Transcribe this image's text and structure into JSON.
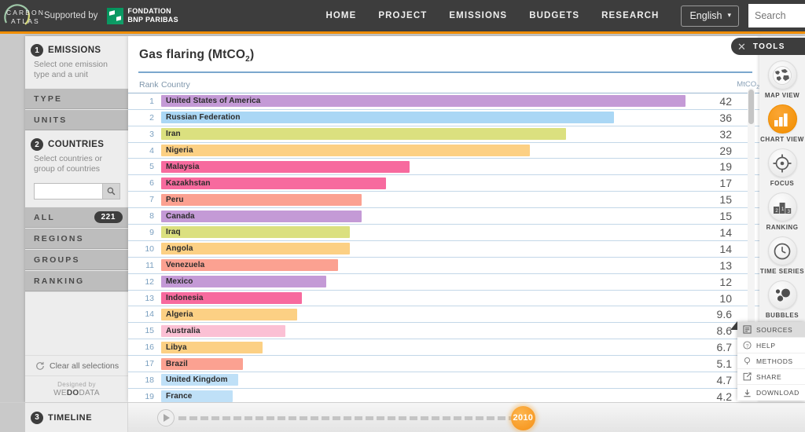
{
  "header": {
    "logo_line1": "CARBON",
    "logo_line2": "ATLAS",
    "supported_by": "Supported by",
    "sponsor_line1": "FONDATION",
    "sponsor_line2": "BNP PARIBAS",
    "nav": [
      {
        "label": "HOME"
      },
      {
        "label": "PROJECT"
      },
      {
        "label": "EMISSIONS"
      },
      {
        "label": "BUDGETS"
      },
      {
        "label": "RESEARCH"
      }
    ],
    "language": "English",
    "language_chevron": "▾",
    "search_placeholder": "Search",
    "search_value": "",
    "accent_color": "#f18e00"
  },
  "sidebar": {
    "emissions": {
      "number": "1",
      "title": "EMISSIONS",
      "subtitle": "Select one emission type and a unit",
      "rows": [
        {
          "label": "TYPE"
        },
        {
          "label": "UNITS"
        }
      ]
    },
    "countries": {
      "number": "2",
      "title": "COUNTRIES",
      "subtitle": "Select countries or group of countries",
      "search_value": "",
      "search_placeholder": "",
      "rows": [
        {
          "label": "ALL",
          "badge": "221"
        },
        {
          "label": "REGIONS",
          "badge": ""
        },
        {
          "label": "GROUPS",
          "badge": ""
        },
        {
          "label": "RANKING",
          "badge": ""
        }
      ]
    },
    "clear_all": "Clear all selections",
    "designed_by": "Designed by",
    "designer_pre": "WE",
    "designer_mid": "DO",
    "designer_post": "DATA"
  },
  "chart": {
    "title_main": "Gas flaring (MtCO",
    "title_sub": "2",
    "title_close": ")",
    "columns": {
      "rank": "Rank",
      "country": "Country",
      "value_main": "MtCO",
      "value_sub": "2"
    }
  },
  "chart_data": {
    "type": "bar",
    "title": "Gas flaring (MtCO2)",
    "xlabel": "MtCO2",
    "ylabel": "Country",
    "orientation": "horizontal",
    "grid": false,
    "legend": "none",
    "xlim": [
      0,
      42
    ],
    "unit": "MtCO2",
    "year": "2010",
    "total_countries": "221",
    "visible_rows": 19,
    "categories": [
      "United States of America",
      "Russian Federation",
      "Iran",
      "Nigeria",
      "Malaysia",
      "Kazakhstan",
      "Peru",
      "Canada",
      "Iraq",
      "Angola",
      "Venezuela",
      "Mexico",
      "Indonesia",
      "Algeria",
      "Australia",
      "Libya",
      "Brazil",
      "United Kingdom",
      "France"
    ],
    "values": [
      42,
      36,
      32,
      29,
      19,
      17,
      15,
      15,
      14,
      14,
      13,
      12,
      10,
      9.6,
      8.6,
      6.7,
      5.1,
      4.7,
      4.2
    ],
    "value_labels": [
      "42",
      "36",
      "32",
      "29",
      "19",
      "17",
      "15",
      "15",
      "14",
      "14",
      "13",
      "12",
      "10",
      "9.6",
      "8.6",
      "6.7",
      "5.1",
      "4.7",
      "4.2"
    ],
    "ranks": [
      "1",
      "2",
      "3",
      "4",
      "5",
      "6",
      "7",
      "8",
      "9",
      "10",
      "11",
      "12",
      "13",
      "14",
      "15",
      "16",
      "17",
      "18",
      "19"
    ],
    "colors": [
      "#c49ad6",
      "#aad7f5",
      "#dbe07f",
      "#fcd084",
      "#f76a9e",
      "#f76a9e",
      "#fba191",
      "#c49ad6",
      "#dbe07f",
      "#fcd084",
      "#fba191",
      "#c49ad6",
      "#f76a9e",
      "#fcd084",
      "#fbc0d4",
      "#fcd084",
      "#fba191",
      "#bfe0f7",
      "#bfe0f7"
    ]
  },
  "tools": {
    "panel_title": "TOOLS",
    "close_icon": "✕",
    "items": [
      {
        "label": "MAP VIEW",
        "icon": "globe-icon",
        "active": false
      },
      {
        "label": "CHART VIEW",
        "icon": "bar-chart-icon",
        "active": true
      },
      {
        "label": "FOCUS",
        "icon": "crosshair-icon",
        "active": false
      },
      {
        "label": "RANKING",
        "icon": "podium-icon",
        "active": false
      },
      {
        "label": "TIME SERIES",
        "icon": "clock-icon",
        "active": false
      },
      {
        "label": "BUBBLES",
        "icon": "bubbles-icon",
        "active": false
      }
    ],
    "menu": [
      {
        "label": "SOURCES",
        "icon": "document-icon",
        "selected": true
      },
      {
        "label": "HELP",
        "icon": "question-icon",
        "selected": false
      },
      {
        "label": "METHODS",
        "icon": "bulb-icon",
        "selected": false
      },
      {
        "label": "SHARE",
        "icon": "share-icon",
        "selected": false
      },
      {
        "label": "DOWNLOAD",
        "icon": "download-icon",
        "selected": false
      }
    ]
  },
  "timeline": {
    "number": "3",
    "title": "TIMELINE",
    "play_icon": "play-icon",
    "year": "2010",
    "progress_percent": 55.5
  }
}
